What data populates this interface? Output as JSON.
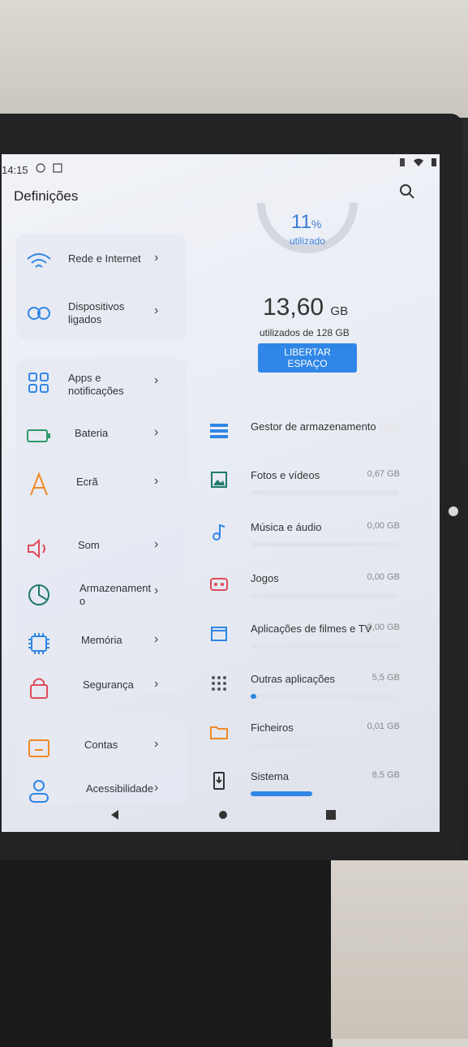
{
  "status_bar": {
    "time": "14:15",
    "left_icons": [
      "whatsapp-icon",
      "notification-icon"
    ],
    "right_icons": [
      "vibrate-icon",
      "wifi-icon",
      "battery-icon"
    ]
  },
  "header": {
    "title": "Definições",
    "search_icon": "search-icon"
  },
  "menu": {
    "items": [
      {
        "label": "Rede e Internet",
        "icon": "wifi-icon",
        "color": "#2f86e6"
      },
      {
        "label": "Dispositivos ligados",
        "icon": "devices-icon",
        "color": "#2f86e6"
      },
      {
        "label": "Apps e notificações",
        "icon": "apps-grid-icon",
        "color": "#2f86e6"
      },
      {
        "label": "Bateria",
        "icon": "battery-icon",
        "color": "#2e9a6a"
      },
      {
        "label": "Ecrã",
        "icon": "display-icon",
        "color": "#f08a24"
      },
      {
        "label": "Som",
        "icon": "speaker-icon",
        "color": "#e04b5a"
      },
      {
        "label": "Armazenament\no",
        "icon": "storage-pie-icon",
        "color": "#1e7a6c"
      },
      {
        "label": "Memória",
        "icon": "memory-chip-icon",
        "color": "#2f86e6"
      },
      {
        "label": "Segurança",
        "icon": "lock-icon",
        "color": "#e04b5a"
      },
      {
        "label": "Contas",
        "icon": "account-icon",
        "color": "#f08a24"
      },
      {
        "label": "Acessibilidade",
        "icon": "person-icon",
        "color": "#2f86e6"
      }
    ]
  },
  "storage": {
    "percent": "11",
    "percent_unit": "%",
    "used_label": "utilizado",
    "used_amount": "13,60",
    "used_unit": "GB",
    "of_total": "utilizados de 128 GB",
    "free_button": "LIBERTAR ESPAÇO",
    "usage_fraction": 0.11,
    "rows": [
      {
        "label": "Gestor de armazenamento",
        "size": "",
        "icon": "storage-manager-icon",
        "fill": null
      },
      {
        "label": "Fotos e vídeos",
        "size": "0,67 GB",
        "icon": "photo-icon",
        "fill": 0.0
      },
      {
        "label": "Música e áudio",
        "size": "0,00 GB",
        "icon": "music-icon",
        "fill": 0.0
      },
      {
        "label": "Jogos",
        "size": "0,00 GB",
        "icon": "game-icon",
        "fill": 0.0
      },
      {
        "label": "Aplicações de filmes e TV",
        "size": "0,00 GB",
        "icon": "movie-icon",
        "fill": 0.0
      },
      {
        "label": "Outras aplicações",
        "size": "5,5 GB",
        "icon": "apps-dots-icon",
        "fill": 0.04
      },
      {
        "label": "Ficheiros",
        "size": "0,01 GB",
        "icon": "folder-icon",
        "fill": 0.0
      },
      {
        "label": "Sistema",
        "size": "8,5 GB",
        "icon": "system-icon",
        "fill": 0.42
      }
    ],
    "toggle_on": false
  },
  "nav_bar": [
    "back-icon",
    "home-icon",
    "recents-icon"
  ],
  "colors": {
    "accent": "#2f86e6"
  }
}
